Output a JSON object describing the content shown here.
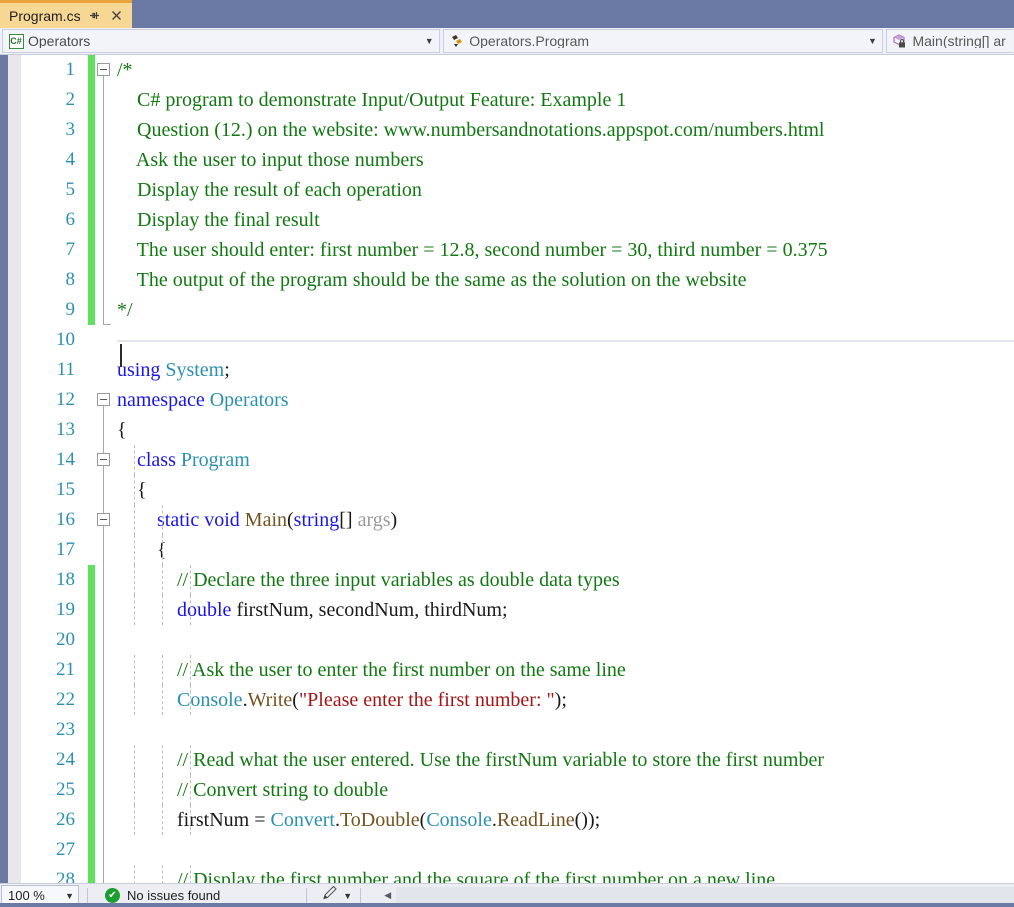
{
  "tab": {
    "label": "Program.cs",
    "pin_icon": "pin-icon",
    "close_icon": "close-icon"
  },
  "navbar": {
    "project_combo": {
      "icon": "csharp-file-icon",
      "icon_text": "C#",
      "value": "Operators",
      "arrow": "▼"
    },
    "type_combo": {
      "icon": "class-members-icon",
      "value": "Operators.Program",
      "arrow": "▼"
    },
    "member_combo": {
      "icon": "method-private-icon",
      "value": "Main(string[] ar",
      "arrow": "▼"
    }
  },
  "editor": {
    "language": "csharp",
    "current_line": 10,
    "colors": {
      "comment": "#127812",
      "keyword": "#1916e8",
      "type": "#2b91af",
      "string": "#a31515",
      "parameter": "#9a9a9a",
      "method": "#74531f",
      "line_number": "#2b91af",
      "change_bar": "#5fe05f",
      "tab_background": "#f7d794",
      "tab_accent": "#e8a33d",
      "chrome": "#6a7aa5"
    },
    "lines": [
      {
        "n": 1,
        "changed": true,
        "text": "/*"
      },
      {
        "n": 2,
        "changed": true,
        "text": "    C# program to demonstrate Input/Output Feature: Example 1"
      },
      {
        "n": 3,
        "changed": true,
        "text": "    Question (12.) on the website: www.numbersandnotations.appspot.com/numbers.html"
      },
      {
        "n": 4,
        "changed": true,
        "text": "    Ask the user to input those numbers"
      },
      {
        "n": 5,
        "changed": true,
        "text": "    Display the result of each operation"
      },
      {
        "n": 6,
        "changed": true,
        "text": "    Display the final result"
      },
      {
        "n": 7,
        "changed": true,
        "text": "    The user should enter: first number = 12.8, second number = 30, third number = 0.375"
      },
      {
        "n": 8,
        "changed": true,
        "text": "    The output of the program should be the same as the solution on the website"
      },
      {
        "n": 9,
        "changed": true,
        "text": "*/"
      },
      {
        "n": 10,
        "changed": false,
        "text": ""
      },
      {
        "n": 11,
        "changed": false,
        "text": "using System;"
      },
      {
        "n": 12,
        "changed": false,
        "text": "namespace Operators"
      },
      {
        "n": 13,
        "changed": false,
        "text": "{"
      },
      {
        "n": 14,
        "changed": false,
        "text": "    class Program"
      },
      {
        "n": 15,
        "changed": false,
        "text": "    {"
      },
      {
        "n": 16,
        "changed": false,
        "text": "        static void Main(string[] args)"
      },
      {
        "n": 17,
        "changed": false,
        "text": "        {"
      },
      {
        "n": 18,
        "changed": true,
        "text": "            // Declare the three input variables as double data types"
      },
      {
        "n": 19,
        "changed": true,
        "text": "            double firstNum, secondNum, thirdNum;"
      },
      {
        "n": 20,
        "changed": true,
        "text": ""
      },
      {
        "n": 21,
        "changed": true,
        "text": "            // Ask the user to enter the first number on the same line"
      },
      {
        "n": 22,
        "changed": true,
        "text": "            Console.Write(\"Please enter the first number: \");"
      },
      {
        "n": 23,
        "changed": true,
        "text": ""
      },
      {
        "n": 24,
        "changed": true,
        "text": "            // Read what the user entered. Use the firstNum variable to store the first number"
      },
      {
        "n": 25,
        "changed": true,
        "text": "            // Convert string to double"
      },
      {
        "n": 26,
        "changed": true,
        "text": "            firstNum = Convert.ToDouble(Console.ReadLine());"
      },
      {
        "n": 27,
        "changed": true,
        "text": ""
      },
      {
        "n": 28,
        "changed": true,
        "text": "            // Display the first number and the square of the first number on a new line"
      }
    ]
  },
  "statusbar": {
    "zoom_level": "100 %",
    "zoom_arrow": "▼",
    "status_icon": "success-check-icon",
    "status_check": "✔",
    "status_text": "No issues found",
    "pen_icon": "feedback-pen-icon",
    "pen_arrow": "▼",
    "scroll_left_arrow": "◀"
  }
}
